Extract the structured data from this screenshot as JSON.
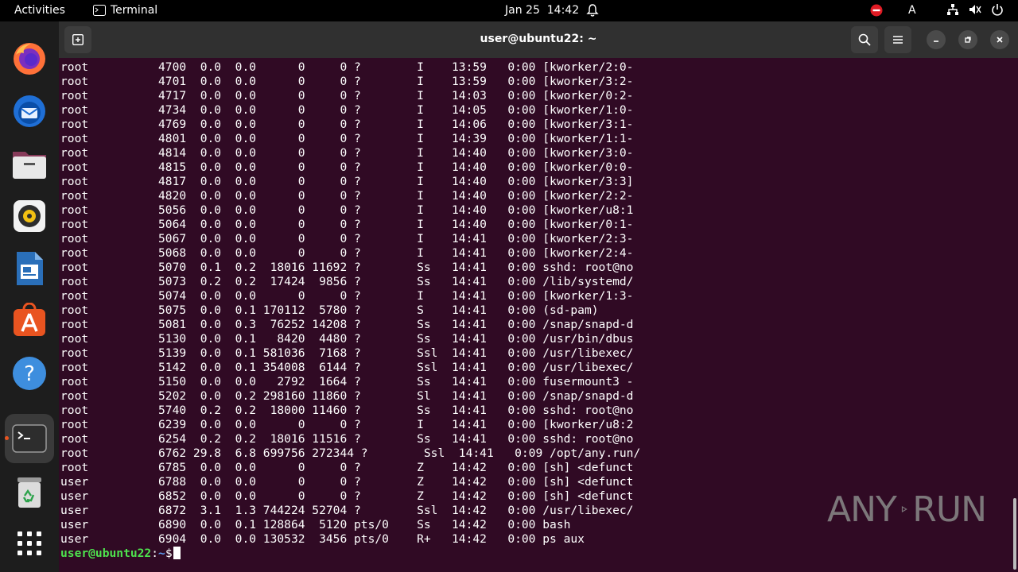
{
  "topbar": {
    "activities": "Activities",
    "app_name": "Terminal",
    "date": "Jan 25",
    "time": "14:42",
    "input_method": "A"
  },
  "window": {
    "title": "user@ubuntu22: ~"
  },
  "dock": {
    "items": [
      "firefox-icon",
      "thunderbird-icon",
      "files-icon",
      "rhythmbox-icon",
      "libreoffice-writer-icon",
      "app-center-icon",
      "help-icon",
      "terminal-icon",
      "trash-icon",
      "show-apps-icon"
    ]
  },
  "terminal": {
    "rows": [
      {
        "user": "root",
        "pid": "4700",
        "cpu": "0.0",
        "mem": "0.0",
        "vsz": "0",
        "rss": "0",
        "tty": "?",
        "stat": "I",
        "start": "13:59",
        "time": "0:00",
        "cmd": "[kworker/2:0-"
      },
      {
        "user": "root",
        "pid": "4701",
        "cpu": "0.0",
        "mem": "0.0",
        "vsz": "0",
        "rss": "0",
        "tty": "?",
        "stat": "I",
        "start": "13:59",
        "time": "0:00",
        "cmd": "[kworker/3:2-"
      },
      {
        "user": "root",
        "pid": "4717",
        "cpu": "0.0",
        "mem": "0.0",
        "vsz": "0",
        "rss": "0",
        "tty": "?",
        "stat": "I",
        "start": "14:03",
        "time": "0:00",
        "cmd": "[kworker/0:2-"
      },
      {
        "user": "root",
        "pid": "4734",
        "cpu": "0.0",
        "mem": "0.0",
        "vsz": "0",
        "rss": "0",
        "tty": "?",
        "stat": "I",
        "start": "14:05",
        "time": "0:00",
        "cmd": "[kworker/1:0-"
      },
      {
        "user": "root",
        "pid": "4769",
        "cpu": "0.0",
        "mem": "0.0",
        "vsz": "0",
        "rss": "0",
        "tty": "?",
        "stat": "I",
        "start": "14:06",
        "time": "0:00",
        "cmd": "[kworker/3:1-"
      },
      {
        "user": "root",
        "pid": "4801",
        "cpu": "0.0",
        "mem": "0.0",
        "vsz": "0",
        "rss": "0",
        "tty": "?",
        "stat": "I",
        "start": "14:39",
        "time": "0:00",
        "cmd": "[kworker/1:1-"
      },
      {
        "user": "root",
        "pid": "4814",
        "cpu": "0.0",
        "mem": "0.0",
        "vsz": "0",
        "rss": "0",
        "tty": "?",
        "stat": "I",
        "start": "14:40",
        "time": "0:00",
        "cmd": "[kworker/3:0-"
      },
      {
        "user": "root",
        "pid": "4815",
        "cpu": "0.0",
        "mem": "0.0",
        "vsz": "0",
        "rss": "0",
        "tty": "?",
        "stat": "I",
        "start": "14:40",
        "time": "0:00",
        "cmd": "[kworker/0:0-"
      },
      {
        "user": "root",
        "pid": "4817",
        "cpu": "0.0",
        "mem": "0.0",
        "vsz": "0",
        "rss": "0",
        "tty": "?",
        "stat": "I",
        "start": "14:40",
        "time": "0:00",
        "cmd": "[kworker/3:3]"
      },
      {
        "user": "root",
        "pid": "4820",
        "cpu": "0.0",
        "mem": "0.0",
        "vsz": "0",
        "rss": "0",
        "tty": "?",
        "stat": "I",
        "start": "14:40",
        "time": "0:00",
        "cmd": "[kworker/2:2-"
      },
      {
        "user": "root",
        "pid": "5056",
        "cpu": "0.0",
        "mem": "0.0",
        "vsz": "0",
        "rss": "0",
        "tty": "?",
        "stat": "I",
        "start": "14:40",
        "time": "0:00",
        "cmd": "[kworker/u8:1"
      },
      {
        "user": "root",
        "pid": "5064",
        "cpu": "0.0",
        "mem": "0.0",
        "vsz": "0",
        "rss": "0",
        "tty": "?",
        "stat": "I",
        "start": "14:40",
        "time": "0:00",
        "cmd": "[kworker/0:1-"
      },
      {
        "user": "root",
        "pid": "5067",
        "cpu": "0.0",
        "mem": "0.0",
        "vsz": "0",
        "rss": "0",
        "tty": "?",
        "stat": "I",
        "start": "14:41",
        "time": "0:00",
        "cmd": "[kworker/2:3-"
      },
      {
        "user": "root",
        "pid": "5068",
        "cpu": "0.0",
        "mem": "0.0",
        "vsz": "0",
        "rss": "0",
        "tty": "?",
        "stat": "I",
        "start": "14:41",
        "time": "0:00",
        "cmd": "[kworker/2:4-"
      },
      {
        "user": "root",
        "pid": "5070",
        "cpu": "0.1",
        "mem": "0.2",
        "vsz": "18016",
        "rss": "11692",
        "tty": "?",
        "stat": "Ss",
        "start": "14:41",
        "time": "0:00",
        "cmd": "sshd: root@no"
      },
      {
        "user": "root",
        "pid": "5073",
        "cpu": "0.2",
        "mem": "0.2",
        "vsz": "17424",
        "rss": "9856",
        "tty": "?",
        "stat": "Ss",
        "start": "14:41",
        "time": "0:00",
        "cmd": "/lib/systemd/"
      },
      {
        "user": "root",
        "pid": "5074",
        "cpu": "0.0",
        "mem": "0.0",
        "vsz": "0",
        "rss": "0",
        "tty": "?",
        "stat": "I",
        "start": "14:41",
        "time": "0:00",
        "cmd": "[kworker/1:3-"
      },
      {
        "user": "root",
        "pid": "5075",
        "cpu": "0.0",
        "mem": "0.1",
        "vsz": "170112",
        "rss": "5780",
        "tty": "?",
        "stat": "S",
        "start": "14:41",
        "time": "0:00",
        "cmd": "(sd-pam)"
      },
      {
        "user": "root",
        "pid": "5081",
        "cpu": "0.0",
        "mem": "0.3",
        "vsz": "76252",
        "rss": "14208",
        "tty": "?",
        "stat": "Ss",
        "start": "14:41",
        "time": "0:00",
        "cmd": "/snap/snapd-d"
      },
      {
        "user": "root",
        "pid": "5130",
        "cpu": "0.0",
        "mem": "0.1",
        "vsz": "8420",
        "rss": "4480",
        "tty": "?",
        "stat": "Ss",
        "start": "14:41",
        "time": "0:00",
        "cmd": "/usr/bin/dbus"
      },
      {
        "user": "root",
        "pid": "5139",
        "cpu": "0.0",
        "mem": "0.1",
        "vsz": "581036",
        "rss": "7168",
        "tty": "?",
        "stat": "Ssl",
        "start": "14:41",
        "time": "0:00",
        "cmd": "/usr/libexec/"
      },
      {
        "user": "root",
        "pid": "5142",
        "cpu": "0.0",
        "mem": "0.1",
        "vsz": "354008",
        "rss": "6144",
        "tty": "?",
        "stat": "Ssl",
        "start": "14:41",
        "time": "0:00",
        "cmd": "/usr/libexec/"
      },
      {
        "user": "root",
        "pid": "5150",
        "cpu": "0.0",
        "mem": "0.0",
        "vsz": "2792",
        "rss": "1664",
        "tty": "?",
        "stat": "Ss",
        "start": "14:41",
        "time": "0:00",
        "cmd": "fusermount3 -"
      },
      {
        "user": "root",
        "pid": "5202",
        "cpu": "0.0",
        "mem": "0.2",
        "vsz": "298160",
        "rss": "11860",
        "tty": "?",
        "stat": "Sl",
        "start": "14:41",
        "time": "0:00",
        "cmd": "/snap/snapd-d"
      },
      {
        "user": "root",
        "pid": "5740",
        "cpu": "0.2",
        "mem": "0.2",
        "vsz": "18000",
        "rss": "11460",
        "tty": "?",
        "stat": "Ss",
        "start": "14:41",
        "time": "0:00",
        "cmd": "sshd: root@no"
      },
      {
        "user": "root",
        "pid": "6239",
        "cpu": "0.0",
        "mem": "0.0",
        "vsz": "0",
        "rss": "0",
        "tty": "?",
        "stat": "I",
        "start": "14:41",
        "time": "0:00",
        "cmd": "[kworker/u8:2"
      },
      {
        "user": "root",
        "pid": "6254",
        "cpu": "0.2",
        "mem": "0.2",
        "vsz": "18016",
        "rss": "11516",
        "tty": "?",
        "stat": "Ss",
        "start": "14:41",
        "time": "0:00",
        "cmd": "sshd: root@no"
      },
      {
        "user": "root",
        "pid": "6762",
        "cpu": "29.8",
        "mem": "6.8",
        "vsz": "699756",
        "rss": "272344",
        "tty": "?",
        "stat": "Ssl",
        "start": "14:41",
        "time": "0:09",
        "cmd": "/opt/any.run/"
      },
      {
        "user": "root",
        "pid": "6785",
        "cpu": "0.0",
        "mem": "0.0",
        "vsz": "0",
        "rss": "0",
        "tty": "?",
        "stat": "Z",
        "start": "14:42",
        "time": "0:00",
        "cmd": "[sh] <defunct"
      },
      {
        "user": "user",
        "pid": "6788",
        "cpu": "0.0",
        "mem": "0.0",
        "vsz": "0",
        "rss": "0",
        "tty": "?",
        "stat": "Z",
        "start": "14:42",
        "time": "0:00",
        "cmd": "[sh] <defunct"
      },
      {
        "user": "user",
        "pid": "6852",
        "cpu": "0.0",
        "mem": "0.0",
        "vsz": "0",
        "rss": "0",
        "tty": "?",
        "stat": "Z",
        "start": "14:42",
        "time": "0:00",
        "cmd": "[sh] <defunct"
      },
      {
        "user": "user",
        "pid": "6872",
        "cpu": "3.1",
        "mem": "1.3",
        "vsz": "744224",
        "rss": "52704",
        "tty": "?",
        "stat": "Ssl",
        "start": "14:42",
        "time": "0:00",
        "cmd": "/usr/libexec/"
      },
      {
        "user": "user",
        "pid": "6890",
        "cpu": "0.0",
        "mem": "0.1",
        "vsz": "128864",
        "rss": "5120",
        "tty": "pts/0",
        "stat": "Ss",
        "start": "14:42",
        "time": "0:00",
        "cmd": "bash"
      },
      {
        "user": "user",
        "pid": "6904",
        "cpu": "0.0",
        "mem": "0.0",
        "vsz": "130532",
        "rss": "3456",
        "tty": "pts/0",
        "stat": "R+",
        "start": "14:42",
        "time": "0:00",
        "cmd": "ps aux"
      }
    ],
    "prompt_user": "user@ubuntu22",
    "prompt_sep": ":",
    "prompt_path": "~",
    "prompt_symbol": "$"
  },
  "watermark": {
    "text_left": "ANY",
    "text_right": "RUN"
  }
}
